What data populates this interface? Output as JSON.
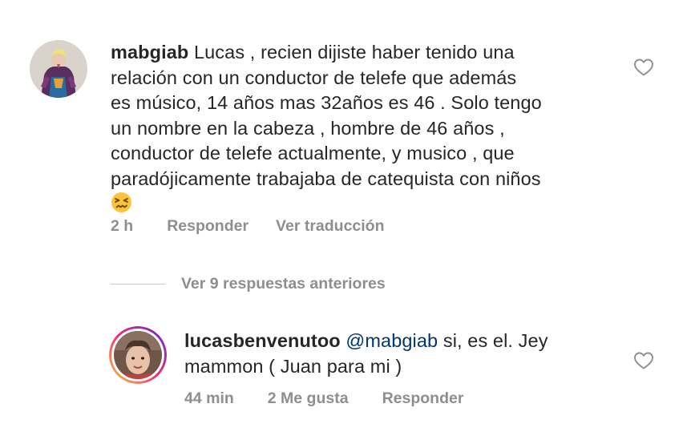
{
  "comments": [
    {
      "username": "mabgiab",
      "text_lines": [
        "Lucas , recien dijiste haber tenido una",
        "relación con un conductor de telefe que además",
        "es músico, 14 años mas 32años es 46 . Solo tengo",
        "un nombre en la cabeza , hombre de 46 años ,",
        "conductor de telefe actualmente, y musico , que",
        "paradójicamente trabajaba de catequista con niños"
      ],
      "emoji": "confounded-face-emoji",
      "time": "2 h",
      "reply_label": "Responder",
      "translate_label": "Ver traducción"
    },
    {
      "username": "lucasbenvenutoo",
      "mention": "@mabgiab",
      "text_line1": "si, es el. Jey",
      "text_line2": "mammon ( Juan para mi )",
      "time": "44 min",
      "likes_label": "2 Me gusta",
      "reply_label": "Responder"
    }
  ],
  "replies_toggle": {
    "label": "Ver 9 respuestas anteriores"
  },
  "icons": {
    "like": "heart-outline-icon"
  },
  "colors": {
    "text": "#262626",
    "secondary": "#8e8e8e",
    "mention": "#00376b",
    "story_ring_start": "#f9ce34",
    "story_ring_mid": "#ee2a7b",
    "story_ring_end": "#6228d7"
  }
}
